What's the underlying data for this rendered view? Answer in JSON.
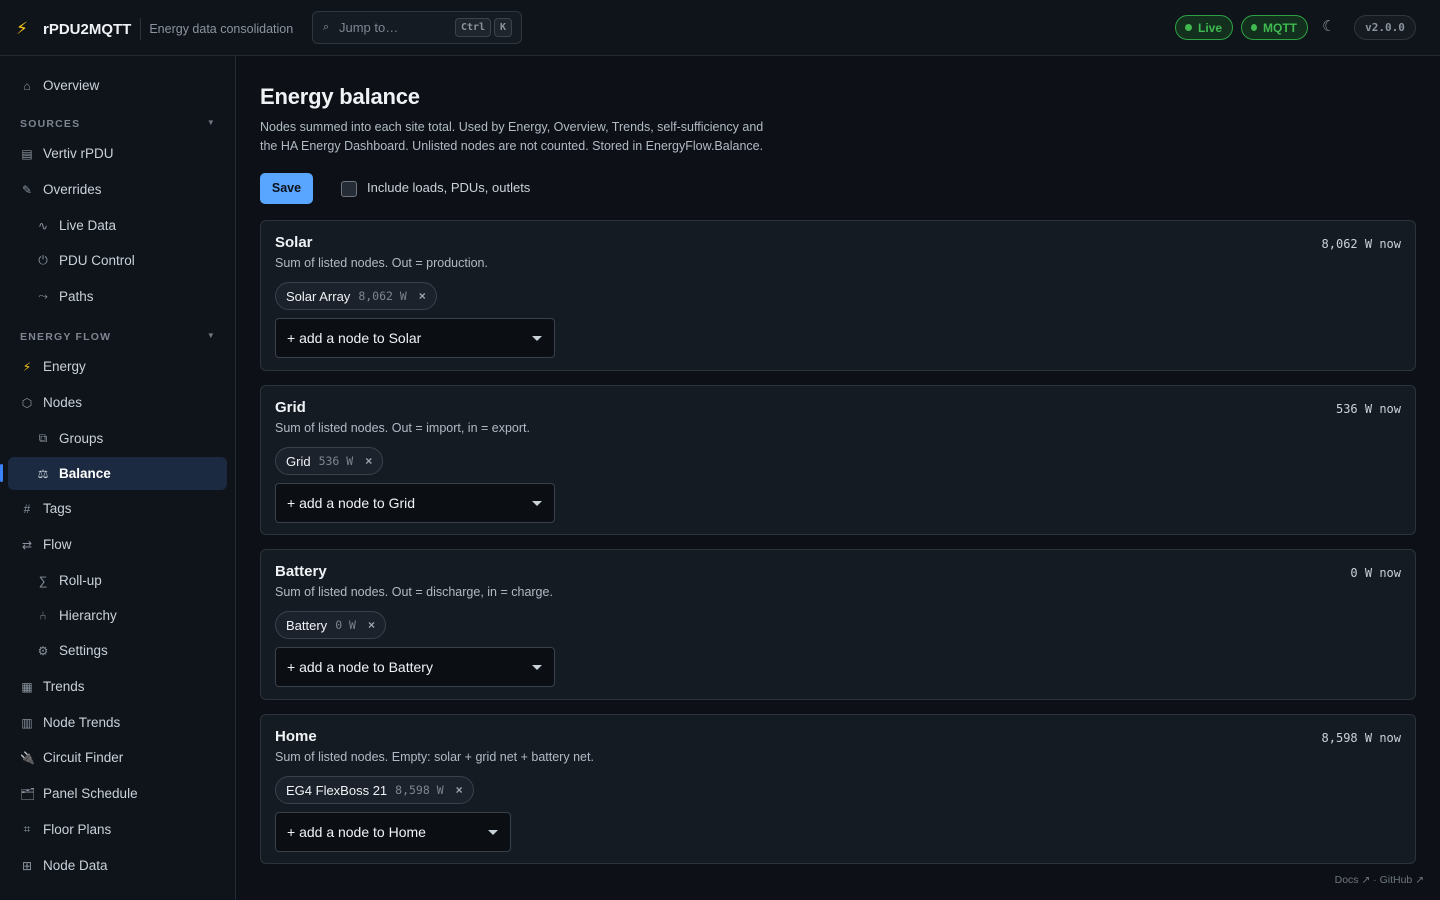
{
  "header": {
    "app_name": "rPDU2MQTT",
    "tagline": "Energy data consolidation",
    "search_placeholder": "Jump to…",
    "shortcut_ctrl": "Ctrl",
    "shortcut_key": "K",
    "status_live": "Live",
    "status_mqtt": "MQTT",
    "version": "v2.0.0",
    "icons": {
      "logo": "lightning-bolt-icon",
      "search": "search-icon",
      "theme": "moon-icon"
    },
    "colors": {
      "status_green": "#3fb950",
      "logo_yellow": "#f5c518"
    }
  },
  "sidebar": {
    "overview": {
      "label": "Overview",
      "icon": "home-icon"
    },
    "sources_heading": "SOURCES",
    "sources": [
      {
        "label": "Vertiv rPDU",
        "icon": "server-icon"
      },
      {
        "label": "Overrides",
        "icon": "pencil-icon"
      },
      {
        "label": "Live Data",
        "icon": "pulse-icon"
      },
      {
        "label": "PDU Control",
        "icon": "power-icon"
      },
      {
        "label": "Paths",
        "icon": "route-icon"
      }
    ],
    "energy_flow_heading": "ENERGY FLOW",
    "energy_flow": [
      {
        "label": "Energy",
        "icon": "lightning-icon"
      },
      {
        "label": "Nodes",
        "icon": "hexagon-icon"
      },
      {
        "label": "Groups",
        "icon": "copy-icon"
      },
      {
        "label": "Balance",
        "icon": "scale-icon"
      },
      {
        "label": "Tags",
        "icon": "hash-icon"
      },
      {
        "label": "Flow",
        "icon": "arrows-icon"
      },
      {
        "label": "Roll-up",
        "icon": "sigma-icon"
      },
      {
        "label": "Hierarchy",
        "icon": "tree-icon"
      },
      {
        "label": "Settings",
        "icon": "gear-icon"
      },
      {
        "label": "Trends",
        "icon": "chart-icon"
      },
      {
        "label": "Node Trends",
        "icon": "bar-chart-icon"
      },
      {
        "label": "Circuit Finder",
        "icon": "plug-icon"
      },
      {
        "label": "Panel Schedule",
        "icon": "folder-icon"
      },
      {
        "label": "Floor Plans",
        "icon": "grid-icon"
      },
      {
        "label": "Node Data",
        "icon": "table-icon"
      }
    ],
    "active_item": "Balance",
    "accent_color": "#3b82f6"
  },
  "main": {
    "title": "Energy balance",
    "description": "Nodes summed into each site total. Used by Energy, Overview, Trends, self-sufficiency and the HA Energy Dashboard. Unlisted nodes are not counted. Stored in EnergyFlow.Balance.",
    "save_label": "Save",
    "include_label": "Include loads, PDUs, outlets",
    "include_checked": false,
    "cards": [
      {
        "title": "Solar",
        "now": "8,062 W now",
        "subtitle": "Sum of listed nodes. Out = production.",
        "chip_name": "Solar Array",
        "chip_watts": "8,062 W",
        "remove": "×",
        "add_label": "+ add a node to Solar"
      },
      {
        "title": "Grid",
        "now": "536 W now",
        "subtitle": "Sum of listed nodes. Out = import, in = export.",
        "chip_name": "Grid",
        "chip_watts": "536 W",
        "remove": "×",
        "add_label": "+ add a node to Grid"
      },
      {
        "title": "Battery",
        "now": "0 W now",
        "subtitle": "Sum of listed nodes. Out = discharge, in = charge.",
        "chip_name": "Battery",
        "chip_watts": "0 W",
        "remove": "×",
        "add_label": "+ add a node to Battery"
      },
      {
        "title": "Home",
        "now": "8,598 W now",
        "subtitle": "Sum of listed nodes. Empty: solar + grid net + battery net.",
        "chip_name": "EG4 FlexBoss 21",
        "chip_watts": "8,598 W",
        "remove": "×",
        "add_label": "+ add a node to Home"
      }
    ],
    "primary_color": "#58a6ff"
  },
  "footer": {
    "docs": "Docs ↗",
    "separator": "·",
    "github": "GitHub ↗"
  }
}
